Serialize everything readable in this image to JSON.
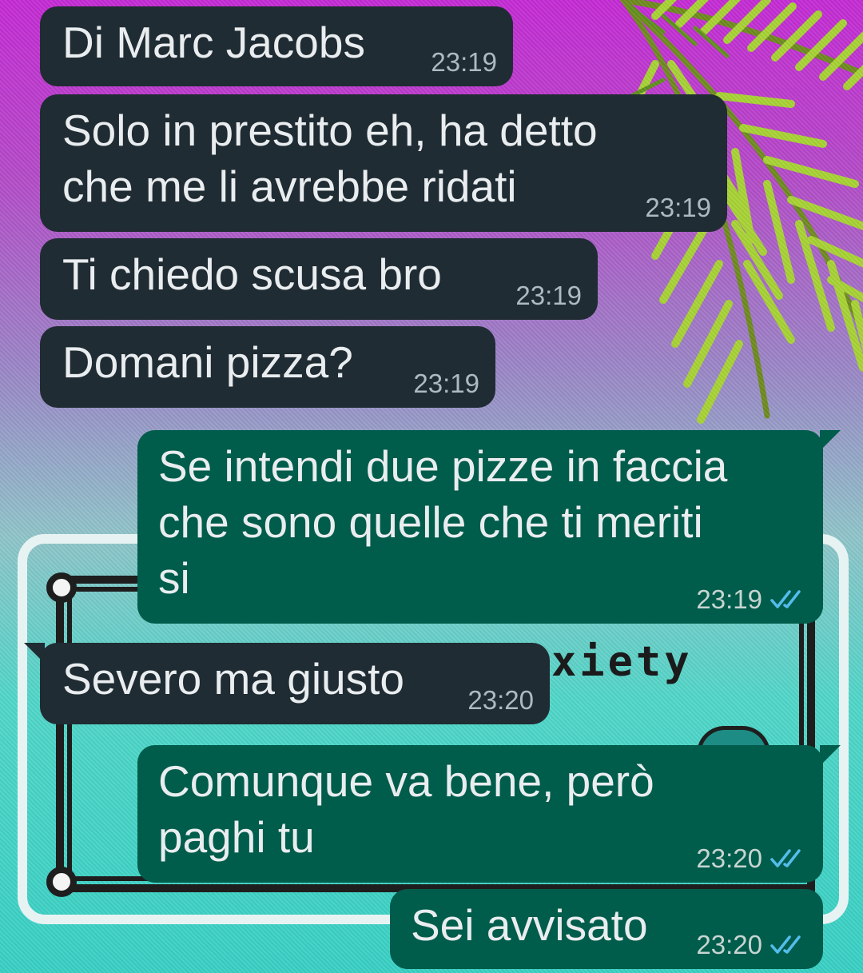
{
  "wallpaper": {
    "pixel_text": "xiety"
  },
  "colors": {
    "incoming_bubble": "#202c33",
    "outgoing_bubble": "#005c4b",
    "message_text": "#e9edef",
    "read_ticks": "#53bdeb"
  },
  "messages": [
    {
      "direction": "incoming",
      "text": "Di Marc Jacobs",
      "time": "23:19"
    },
    {
      "direction": "incoming",
      "text": "Solo in prestito eh, ha detto\nche me li avrebbe ridati",
      "time": "23:19"
    },
    {
      "direction": "incoming",
      "text": "Ti chiedo scusa bro",
      "time": "23:19"
    },
    {
      "direction": "incoming",
      "text": "Domani pizza?",
      "time": "23:19"
    },
    {
      "direction": "outgoing",
      "text": "Se intendi due pizze in faccia\nche sono quelle che ti meriti\nsi",
      "time": "23:19",
      "status": "read"
    },
    {
      "direction": "incoming",
      "text": "Severo ma giusto",
      "time": "23:20"
    },
    {
      "direction": "outgoing",
      "text": "Comunque va bene, però\npaghi tu",
      "time": "23:20",
      "status": "read"
    },
    {
      "direction": "outgoing",
      "text": "Sei avvisato",
      "time": "23:20",
      "status": "read"
    }
  ]
}
